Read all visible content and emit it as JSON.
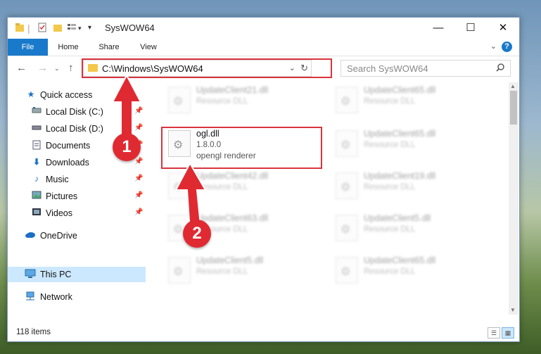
{
  "window": {
    "title": "SysWOW64",
    "minimize": "—",
    "maximize": "☐",
    "close": "✕"
  },
  "ribbon": {
    "tabs": [
      "File",
      "Home",
      "Share",
      "View"
    ],
    "help": "?"
  },
  "navbar": {
    "address": "C:\\Windows\\SysWOW64",
    "search_placeholder": "Search SysWOW64"
  },
  "sidebar": {
    "items": [
      {
        "label": "Quick access",
        "icon": "star-icon",
        "pinned": false
      },
      {
        "label": "Local Disk (C:)",
        "icon": "drive-icon",
        "pinned": true
      },
      {
        "label": "Local Disk (D:)",
        "icon": "drive-icon",
        "pinned": true
      },
      {
        "label": "Documents",
        "icon": "documents-icon",
        "pinned": true
      },
      {
        "label": "Downloads",
        "icon": "download-icon",
        "pinned": true
      },
      {
        "label": "Music",
        "icon": "music-icon",
        "pinned": true
      },
      {
        "label": "Pictures",
        "icon": "pictures-icon",
        "pinned": true
      },
      {
        "label": "Videos",
        "icon": "videos-icon",
        "pinned": true
      },
      {
        "label": "OneDrive",
        "icon": "cloud-icon",
        "pinned": false
      },
      {
        "label": "This PC",
        "icon": "computer-icon",
        "pinned": false,
        "selected": true
      },
      {
        "label": "Network",
        "icon": "network-icon",
        "pinned": false
      }
    ]
  },
  "files": {
    "left": [
      {
        "name": "UpdateClient21.dll",
        "desc": "Resource DLL"
      },
      {
        "name": "ogl.dll",
        "desc": "1.8.0.0",
        "desc2": "opengl renderer",
        "focus": true
      },
      {
        "name": "UpdateClient42.dll",
        "desc": "Resource DLL"
      },
      {
        "name": "UpdateClient63.dll",
        "desc": "Resource DLL"
      },
      {
        "name": "UpdateClient5.dll",
        "desc": "Resource DLL"
      }
    ],
    "right": [
      {
        "name": "UpdateClient65.dll",
        "desc": "Resource DLL"
      },
      {
        "name": "UpdateClient65.dll",
        "desc": "Resource DLL"
      },
      {
        "name": "UpdateClient19.dll",
        "desc": "Resource DLL"
      },
      {
        "name": "UpdateClient5.dll",
        "desc": "Resource DLL"
      },
      {
        "name": "UpdateClient65.dll",
        "desc": "Resource DLL"
      }
    ]
  },
  "status": {
    "count": "118 items"
  },
  "annotations": {
    "badge1": "1",
    "badge2": "2",
    "color": "#e02a32"
  }
}
